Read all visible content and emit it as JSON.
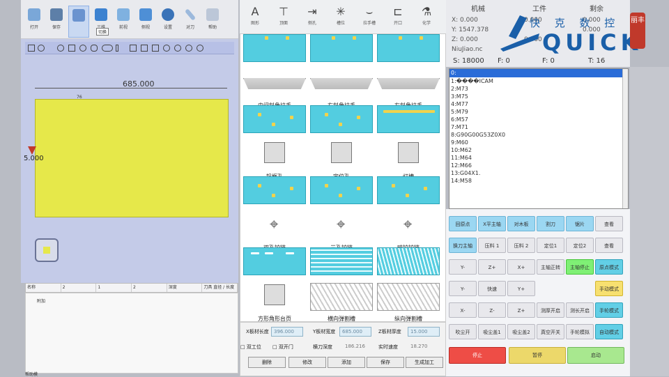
{
  "colors": {
    "panel": "#e6e84a",
    "accent_blue": "#2a6cd8",
    "logo": "#1a5fa8"
  },
  "toolbar": {
    "buttons": [
      {
        "label": "打开",
        "icon": "folder-icon"
      },
      {
        "label": "保存",
        "icon": "save-icon"
      },
      {
        "label": "",
        "icon": "select-icon"
      },
      {
        "label": "三维",
        "icon": "cube-3d-icon"
      },
      {
        "label": "前视",
        "icon": "cube-front-icon"
      },
      {
        "label": "侧视",
        "icon": "cube-side-icon"
      },
      {
        "label": "设置",
        "icon": "gear-icon"
      },
      {
        "label": "对刀",
        "icon": "ruler-icon"
      },
      {
        "label": "帮助",
        "icon": "help-icon"
      }
    ],
    "tooltip": "切换"
  },
  "canvas": {
    "width_dim": "685.000",
    "height_dim": "5.000",
    "small_label": "76"
  },
  "info_row": [
    "名称",
    "2",
    "1",
    "2",
    "深度",
    "刀具 直径 / 长度"
  ],
  "lower_label": "附加",
  "template_top": [
    {
      "label": "图形",
      "glyph": "A"
    },
    {
      "label": "顶面",
      "glyph": "⊤"
    },
    {
      "label": "侧孔",
      "glyph": "⇥"
    },
    {
      "label": "槽位",
      "glyph": "✳"
    },
    {
      "label": "拉手槽",
      "glyph": "⌣"
    },
    {
      "label": "开口",
      "glyph": "⊏"
    },
    {
      "label": "化学",
      "glyph": "⚗"
    }
  ],
  "templates": [
    {
      "label": "",
      "style": "cyan-top"
    },
    {
      "label": "",
      "style": "cyan-top"
    },
    {
      "label": "",
      "style": "cyan-top"
    },
    {
      "label": "中间斜角拉手",
      "style": "tray"
    },
    {
      "label": "右斜角拉手",
      "style": "tray"
    },
    {
      "label": "左斜角拉手",
      "style": "tray"
    },
    {
      "label": "",
      "style": "cyan-dots"
    },
    {
      "label": "",
      "style": "cyan-dots"
    },
    {
      "label": "",
      "style": "cyan-bar"
    },
    {
      "label": "铝框孔",
      "style": "part"
    },
    {
      "label": "定位孔",
      "style": "part"
    },
    {
      "label": "灯槽",
      "style": "part"
    },
    {
      "label": "",
      "style": "cyan-dots"
    },
    {
      "label": "",
      "style": "cyan-dots"
    },
    {
      "label": "",
      "style": "cyan-dots"
    },
    {
      "label": "双孔铰链",
      "style": "hinge"
    },
    {
      "label": "三孔铰链",
      "style": "hinge"
    },
    {
      "label": "暗铰铰链",
      "style": "hinge"
    },
    {
      "label": "",
      "style": "cyan-slots"
    },
    {
      "label": "",
      "style": "stripes"
    },
    {
      "label": "",
      "style": "vstripes"
    },
    {
      "label": "方形角形台页",
      "style": "part"
    },
    {
      "label": "横向弹割槽",
      "style": "diag"
    },
    {
      "label": "纵向弹割槽",
      "style": "diag"
    }
  ],
  "params": {
    "x_label": "X板材长度",
    "x_value": "396.000",
    "y_label": "Y板材宽度",
    "y_value": "685.000",
    "z_label": "Z板材厚度",
    "z_value": "15.000",
    "chk1": "□ 双工位",
    "chk2": "□ 双开门",
    "feed_label": "横刀深度",
    "feed_value": "186.216",
    "speed_label": "实时速度",
    "speed_value": "18.270",
    "buttons": [
      "删除",
      "修改",
      "添加",
      "保存",
      "生成加工"
    ]
  },
  "coord": {
    "headers": [
      "机械",
      "工件",
      "剩余"
    ],
    "x": "X: 0.000",
    "y": "Y: 1547.378",
    "z": "Z: 0.000",
    "wx": "0.000",
    "wz": "0.000",
    "rx": "0.000",
    "ry": "0.000",
    "file": "NiuJiao.nc",
    "s": "S: 18000",
    "f1": "F: 0",
    "f2": "F: 0",
    "t": "T: 16"
  },
  "logo": {
    "cn": "快 克 数 控",
    "en": "QUICK",
    "seal": "丽丰"
  },
  "gcode": [
    "0:",
    "1:����ICAM",
    "2:M73",
    "3:M75",
    "4:M77",
    "5:M79",
    "6:M57",
    "7:M71",
    "8:G90G00G53Z0X0",
    "9:M60",
    "10:M62",
    "11:M64",
    "12:M66",
    "13:G04X1.",
    "14:M58"
  ],
  "controls": {
    "row1": [
      "回原点",
      "X平主轴",
      "对木板",
      "割刀",
      "锯片",
      "查看"
    ],
    "row2": [
      "换刀主轴",
      "压料 1",
      "压料 2",
      "定位1",
      "定位2",
      "查看"
    ],
    "row3": [
      "Y-",
      "Z+",
      "X+",
      "主轴正转",
      "主轴停止",
      "原点模式"
    ],
    "row4": [
      "Y-",
      "快速",
      "Y+",
      "",
      "",
      "手动模式"
    ],
    "row5": [
      "X-",
      "Z-",
      "Z+",
      "测厚开启",
      "测长开启",
      "手轮模式"
    ],
    "row6": [
      "吹尘开",
      "吸尘盖1",
      "吸尘盖2",
      "真空开关",
      "手轮模拟",
      "自动模式"
    ],
    "stop": "停止",
    "pause": "暂停",
    "start": "启动"
  },
  "corner_label": "帮助模"
}
